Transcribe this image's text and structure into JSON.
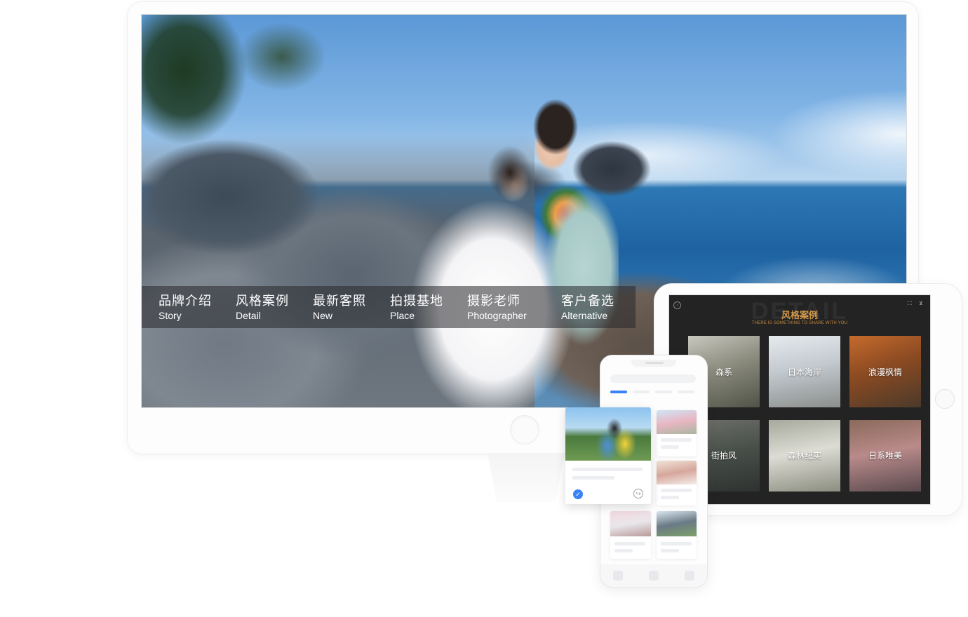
{
  "desktop": {
    "nav": [
      {
        "cn": "品牌介绍",
        "en": "Story"
      },
      {
        "cn": "风格案例",
        "en": "Detail"
      },
      {
        "cn": "最新客照",
        "en": "New"
      },
      {
        "cn": "拍摄基地",
        "en": "Place"
      },
      {
        "cn": "摄影老师",
        "en": "Photographer"
      },
      {
        "cn": "客户备选",
        "en": "Alternative"
      }
    ]
  },
  "tablet": {
    "ghost": "DETAIL",
    "title": "风格案例",
    "subtitle": "THERE IS SOMETHING TO SHARE WITH YOU",
    "cards": [
      {
        "label": "森系"
      },
      {
        "label": "日本海岸"
      },
      {
        "label": "浪漫枫情"
      },
      {
        "label": "街拍风"
      },
      {
        "label": "森林纪实"
      },
      {
        "label": "日系唯美"
      }
    ]
  },
  "phone": {
    "check_icon": "check-circle-icon",
    "share_icon": "share-icon"
  },
  "colors": {
    "accent_blue": "#3b82f6",
    "tablet_title": "#d49a4a",
    "tablet_bg": "#232323"
  }
}
